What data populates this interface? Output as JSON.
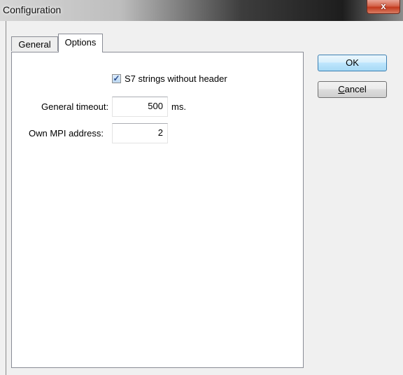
{
  "window": {
    "title": "Configuration",
    "close_glyph": "x"
  },
  "tabs": [
    {
      "label": "General",
      "active": false
    },
    {
      "label": "Options",
      "active": true
    }
  ],
  "options": {
    "s7_strings": {
      "label": "S7 strings without header",
      "checked": true,
      "check_glyph": "✓"
    },
    "general_timeout": {
      "label": "General timeout:",
      "value": "500",
      "unit": "ms."
    },
    "mpi_address": {
      "label": "Own MPI address:",
      "value": "2"
    }
  },
  "buttons": {
    "ok_label": "OK",
    "cancel_mnemonic": "C",
    "cancel_rest": "ancel"
  },
  "colors": {
    "ok_border": "#3c7fb1",
    "close_button": "#c2391d",
    "checkbox_fill": "#bcd7f1"
  },
  "icons": {
    "close": "close-icon",
    "checkmark": "checkmark-icon"
  }
}
